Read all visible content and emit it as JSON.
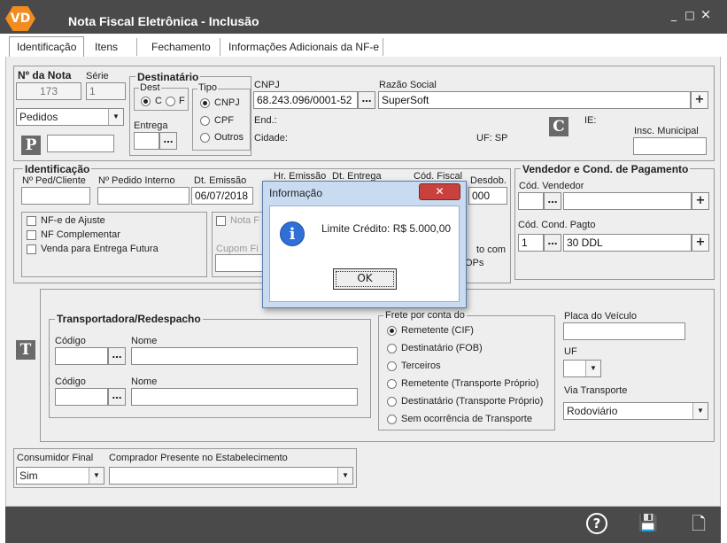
{
  "window": {
    "logo": "VD",
    "title": "Nota Fiscal Eletrônica - Inclusão",
    "minimize": "_",
    "restore": "□",
    "close": "×"
  },
  "tabs": [
    {
      "label": "Identificação"
    },
    {
      "label": "Itens"
    },
    {
      "label": "Fechamento"
    },
    {
      "label": "Informações Adicionais da NF-e"
    }
  ],
  "nota": {
    "label": "Nº da Nota",
    "serie_label": "Série",
    "numero": "173",
    "serie": "1",
    "tipo_select": "Pedidos",
    "p_box": "P"
  },
  "destinatario": {
    "title": "Destinatário",
    "dest_label": "Dest",
    "dest_c": "C",
    "dest_f": "F",
    "tipo_label": "Tipo",
    "tipo_cnpj": "CNPJ",
    "tipo_cpf": "CPF",
    "tipo_outros": "Outros",
    "entrega_label": "Entrega",
    "cnpj_label": "CNPJ",
    "cnpj": "68.243.096/0001-52",
    "razao_label": "Razão Social",
    "razao": "SuperSoft",
    "end_label": "End.:",
    "cidade_label": "Cidade:",
    "uf": "UF: SP",
    "c_box": "C",
    "ie_label": "IE:",
    "insc_label": "Insc. Municipal"
  },
  "identificacao": {
    "title": "Identificação",
    "ped_cliente": "Nº Ped/Cliente",
    "pedido_interno": "Nº Pedido Interno",
    "dt_emissao": "Dt. Emissão",
    "dt_emissao_val": "06/07/2018",
    "hr_emissao": "Hr. Emissão",
    "dt_entrega": "Dt. Entrega",
    "cod_fiscal": "Cód. Fiscal",
    "desdob": "Desdob.",
    "desdob_val": "000",
    "chk_ajuste": "NF-e de Ajuste",
    "chk_complementar": "NF Complementar",
    "chk_venda": "Venda para Entrega Futura",
    "nota_f": "Nota F",
    "cupom_f": "Cupom Fi",
    "partial_to_com": "to com",
    "partial_ops": "OPs"
  },
  "vendedor": {
    "title": "Vendedor e Cond. de Pagamento",
    "cod_vendedor": "Cód. Vendedor",
    "cod_cond": "Cód. Cond. Pagto",
    "cond_codigo": "1",
    "cond_desc": "30 DDL"
  },
  "transportadora": {
    "t_box": "T",
    "title": "Transportadora/Redespacho",
    "codigo1": "Código",
    "nome1": "Nome",
    "codigo2": "Código",
    "nome2": "Nome"
  },
  "frete": {
    "title": "Frete por conta do",
    "options": [
      "Remetente (CIF)",
      "Destinatário (FOB)",
      "Terceiros",
      "Remetente (Transporte Próprio)",
      "Destinatário (Transporte Próprio)",
      "Sem ocorrência de Transporte"
    ],
    "placa_label": "Placa do Veículo",
    "uf_label": "UF",
    "via_label": "Via Transporte",
    "via_val": "Rodoviário"
  },
  "consumidor": {
    "label": "Consumidor Final",
    "val": "Sim",
    "comprador_label": "Comprador Presente no Estabelecimento"
  },
  "dialog": {
    "title": "Informação",
    "close": "✕",
    "message": "Limite Crédito: R$ 5.000,00",
    "ok": "OK",
    "icon": "i"
  },
  "footer": {
    "help": "?",
    "save": "💾",
    "cancel": "🗋"
  }
}
